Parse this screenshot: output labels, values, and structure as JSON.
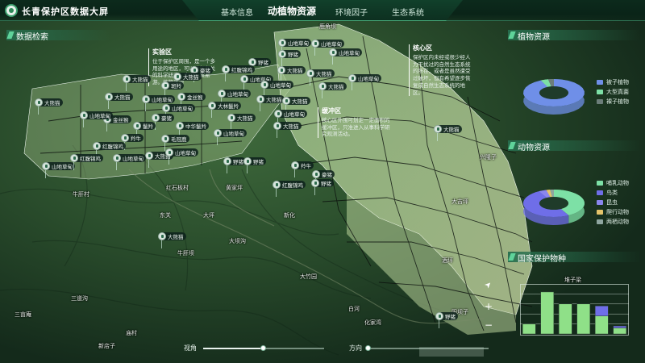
{
  "app": {
    "title": "长青保护区数据大屏"
  },
  "nav": {
    "tabs": [
      "基本信息",
      "动植物资源",
      "环境因子",
      "生态系统"
    ],
    "active_index": 1
  },
  "panels": {
    "data_search": "数据检索",
    "plant_resources": "植物资源",
    "animal_resources": "动物资源",
    "protected_species": "国家保护物种"
  },
  "zones": {
    "experiment": {
      "title": "实验区",
      "text": "位于保护区周围，是一个多用途的地区，可以进行有关的科学研究，也可开展旅游。植物资源"
    },
    "core": {
      "title": "核心区",
      "text": "保护区内未经或很少经人为干扰过的自然生态系统的所在，或者是虽然遭受过破坏，但有希望逐步恢复成自然生态系统的地区。"
    },
    "buffer": {
      "title": "缓冲区",
      "text": "核心区外围可划定一定面积的缓冲区，只准进入从事科学研究观测活动。"
    }
  },
  "places": [
    "鹿角坝",
    "红石板村",
    "黄家坪",
    "东关",
    "大坪",
    "牛肝坝",
    "三道沟",
    "大坝沟",
    "庙村",
    "三亩庵",
    "新店子",
    "新化",
    "化家湾",
    "白河",
    "大竹园",
    "阳坝子",
    "兴隆子",
    "酒坪",
    "牛肝村",
    "大吉坪",
    "堆子梁"
  ],
  "pins": [
    "林麝",
    "山地草甸",
    "野猪",
    "大熊猫",
    "羚牛",
    "红腹锦鸡",
    "豪猪",
    "鬣羚",
    "毛冠鹿",
    "中华鬣羚",
    "金丝猴",
    "斑羚",
    "黄喉貂",
    "大林鬣羚",
    "白冠长尾雉"
  ],
  "plant_chart": {
    "legend": [
      {
        "label": "被子植物",
        "color": "#6f8fe8"
      },
      {
        "label": "大型真菌",
        "color": "#7de0a6"
      },
      {
        "label": "裸子植物",
        "color": "#6c7e7a"
      }
    ],
    "values": [
      0.93,
      0.04,
      0.03
    ]
  },
  "animal_chart": {
    "legend": [
      {
        "label": "哺乳动物",
        "color": "#7de0a6"
      },
      {
        "label": "鸟类",
        "color": "#6f6ee8"
      },
      {
        "label": "昆虫",
        "color": "#8a86ee"
      },
      {
        "label": "爬行动物",
        "color": "#e4c46a"
      },
      {
        "label": "两栖动物",
        "color": "#8fa6a0"
      }
    ],
    "values": [
      0.42,
      0.5,
      0.04,
      0.02,
      0.02
    ]
  },
  "chart_data": {
    "type": "bar",
    "categories": [
      "1",
      "2",
      "3",
      "4",
      "5",
      "6"
    ],
    "series": [
      {
        "values": [
          10,
          42,
          30,
          30,
          18,
          6
        ]
      },
      {
        "values": [
          0,
          0,
          0,
          0,
          10,
          2
        ]
      }
    ],
    "ylim": [
      0,
      50
    ],
    "grid": true
  },
  "controls": {
    "view_angle_label": "视角",
    "view_angle": 0.49,
    "direction_label": "方向",
    "direction": 0.0,
    "compass": "➤",
    "zoom_in": "+",
    "zoom_out": "−"
  }
}
